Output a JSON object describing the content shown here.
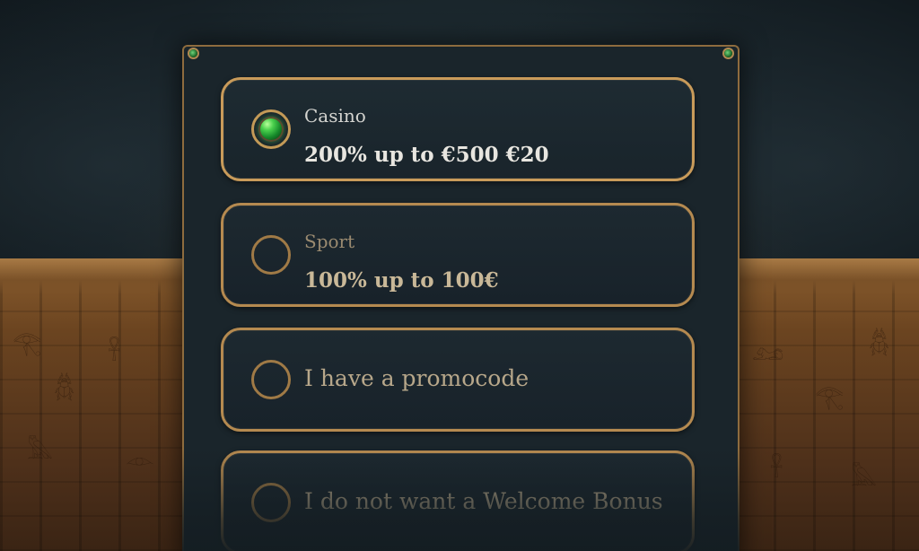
{
  "options": [
    {
      "title": "Casino",
      "value": "200% up to €500 €20",
      "selected": true,
      "icon": "emerald-gem-icon"
    },
    {
      "title": "Sport",
      "value": "100% up to 100€",
      "selected": false
    },
    {
      "label": "I have a promocode",
      "selected": false
    },
    {
      "label": "I do not want a Welcome Bonus",
      "selected": false
    }
  ],
  "colors": {
    "panel": "#1a252b",
    "border_gold": "#b58a50",
    "gem_green": "#4bd14e"
  }
}
